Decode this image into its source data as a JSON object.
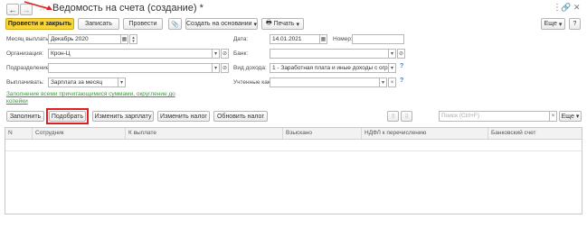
{
  "window": {
    "title": "Ведомость на счета (создание) *",
    "nav_back": "←",
    "nav_forward": "→",
    "star": "☆",
    "menu_dots": "⋮",
    "close": "✕"
  },
  "toolbar": {
    "post_and_close": "Провести и закрыть",
    "save": "Записать",
    "post": "Провести",
    "attach_icon": "paperclip-icon",
    "create_based": "Создать на основании",
    "print": "Печать",
    "more": "Еще",
    "help": "?"
  },
  "form": {
    "payout_month_label": "Месяц выплаты:",
    "payout_month_value": "Декабрь 2020",
    "date_label": "Дата:",
    "date_value": "14.01.2021",
    "number_label": "Номер:",
    "number_value": "",
    "org_label": "Организация:",
    "org_value": "Крон-Ц",
    "bank_label": "Банк:",
    "bank_value": "",
    "dept_label": "Подразделение:",
    "dept_value": "",
    "income_type_label": "Вид дохода:",
    "income_type_value": "1 - Заработная плата и иные доходы с огран",
    "pay_label": "Выплачивать:",
    "pay_value": "Зарплата за месяц",
    "accounted_label": "Учтенные как:",
    "accounted_value": "",
    "fill_link": "Заполнение всеми причитающимися суммами, округление до копейки"
  },
  "table_toolbar": {
    "fill": "Заполнить",
    "pick": "Подобрать",
    "change_salary": "Изменить зарплату",
    "change_tax": "Изменить налог",
    "refresh_tax": "Обновить налог",
    "search_placeholder": "Поиск (Ctrl+F)",
    "more": "Еще"
  },
  "table": {
    "columns": [
      "N",
      "Сотрудник",
      "К выплате",
      "Взыскано",
      "НДФЛ к перечислению",
      "Банковский счет"
    ]
  },
  "colors": {
    "primary_button": "#f8d538",
    "highlight": "#e02020",
    "link": "#3a9a3a"
  }
}
